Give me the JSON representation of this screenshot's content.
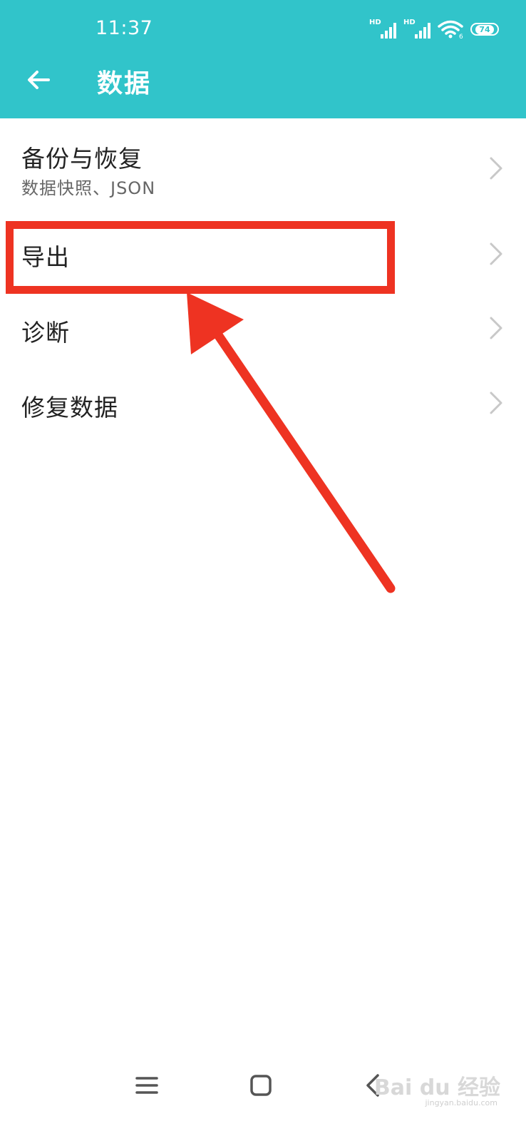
{
  "status_bar": {
    "time": "11:37",
    "signal1_label": "HD",
    "signal2_label": "HD",
    "wifi_label": "6",
    "battery": "74"
  },
  "app_bar": {
    "title": "数据"
  },
  "menu": {
    "items": [
      {
        "title": "备份与恢复",
        "subtitle": "数据快照、JSON"
      },
      {
        "title": "导出"
      },
      {
        "title": "诊断"
      },
      {
        "title": "修复数据"
      }
    ]
  },
  "annotation": {
    "highlight_color": "#ee3322"
  },
  "watermark": {
    "brand": "Bai du 经验",
    "url": "jingyan.baidu.com"
  },
  "colors": {
    "accent": "#31c4ca"
  }
}
